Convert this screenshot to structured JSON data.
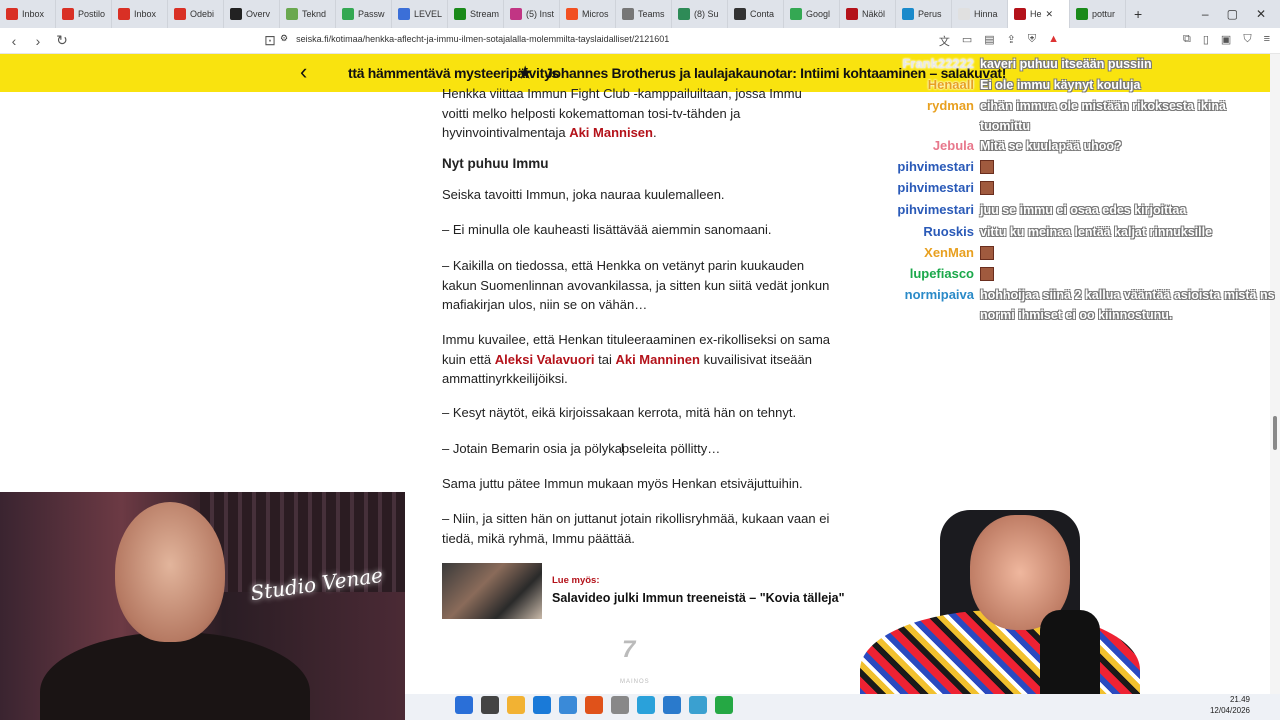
{
  "browser": {
    "tabs": [
      {
        "label": "Inbox",
        "color": "#d93025"
      },
      {
        "label": "Postilo",
        "color": "#d93025"
      },
      {
        "label": "Inbox",
        "color": "#d93025"
      },
      {
        "label": "Odebi",
        "color": "#d93025"
      },
      {
        "label": "Overv",
        "color": "#222222"
      },
      {
        "label": "Teknd",
        "color": "#6aa84f"
      },
      {
        "label": "Passw",
        "color": "#34a853"
      },
      {
        "label": "LEVEL",
        "color": "#3b6fd8"
      },
      {
        "label": "Stream",
        "color": "#1a8a1a"
      },
      {
        "label": "(5) Inst",
        "color": "#c13584"
      },
      {
        "label": "Micros",
        "color": "#f25022"
      },
      {
        "label": "Teams",
        "color": "#777777"
      },
      {
        "label": "(8) Su",
        "color": "#2e8b57"
      },
      {
        "label": "Conta",
        "color": "#333333"
      },
      {
        "label": "Googl",
        "color": "#34a853"
      },
      {
        "label": "Näköl",
        "color": "#b4121a"
      },
      {
        "label": "Perus",
        "color": "#1a8acb"
      },
      {
        "label": "Hinna",
        "color": "#e0e0e0"
      },
      {
        "label": "He",
        "color": "#b4121a",
        "active": true
      },
      {
        "label": "pottur",
        "color": "#1a8a1a"
      }
    ],
    "new_tab": "+",
    "url": "seiska.fi/kotimaa/henkka-aflecht-ja-immu-ilmen-sotajalalla-molemmilta-tayslaidalliset/2121601"
  },
  "banner": {
    "left_text": "ttä hämmentävä mysteeripäivitys",
    "star": "★",
    "right_text": "Johannes Brotherus ja laulajakaunotar: Intiimi kohtaaminen – salakuvat!"
  },
  "article": {
    "p0_a": "Henkka viittaa Immun Fight Club -kamppailuiltaan, jossa Immu voitti melko helposti kokemattoman tosi-tv-tähden ja hyvinvointivalmentaja ",
    "p0_link": "Aki Mannisen",
    "p0_b": ".",
    "heading": "Nyt puhuu Immu",
    "p1": "Seiska tavoitti Immun, joka nauraa kuulemalleen.",
    "p2": "– Ei minulla ole kauheasti lisättävää aiemmin sanomaani.",
    "p3": "– Kaikilla on tiedossa, että Henkka on vetänyt parin kuukauden kakun Suomenlinnan avovankilassa, ja sitten kun siitä vedät jonkun mafiakirjan ulos, niin se on vähän…",
    "p4_a": "Immu kuvailee, että Henkan tituleeraaminen ex-rikolliseksi on sama kuin että ",
    "p4_link1": "Aleksi Valavuori",
    "p4_mid": " tai ",
    "p4_link2": "Aki Manninen",
    "p4_b": " kuvailisivat itseään ammattinyrkkeilijöiksi.",
    "p5": "– Kesyt näytöt, eikä kirjoissakaan kerrota, mitä hän on tehnyt.",
    "p6": "– Jotain Bemarin osia ja pölykapseleita pöllitty…",
    "p7": "Sama juttu pätee Immun mukaan myös Henkan etsiväjuttuihin.",
    "p8": "– Niin, ja sitten hän on juttanut jotain rikollisryhmää, kukaan vaan ei tiedä, mikä ryhmä, Immu päättää.",
    "related_kicker": "Lue myös:",
    "related_title": "Salavideo julki Immun treeneistä – \"Kovia tälleja\"",
    "ad_label": "MAINOS"
  },
  "chat": [
    {
      "name": "Frank22222",
      "color": "#e8e8e8",
      "text": "kaveri puhuu itseään pussiin"
    },
    {
      "name": "Henaall",
      "color": "#e8a020",
      "text": "Ei ole immu käynyt koulujа"
    },
    {
      "name": "rydman",
      "color": "#e8a020",
      "text": "eihän immua ole mistään rikoksesta ikinä tuomittu"
    },
    {
      "name": "Jebula",
      "color": "#e8788c",
      "text": "Mitä se kuulapää uhoo?"
    },
    {
      "name": "pihvimestari",
      "color": "#2a5ab8",
      "text": "",
      "emote": true
    },
    {
      "name": "pihvimestari",
      "color": "#2a5ab8",
      "text": "",
      "emote": true
    },
    {
      "name": "pihvimestari",
      "color": "#2a5ab8",
      "text": "juu se immu ei osaa edes kirjoittaa"
    },
    {
      "name": "Ruoskis",
      "color": "#2a5ab8",
      "text": "vittu ku meinaa lentää kaljat rinnuksille"
    },
    {
      "name": "XenMan",
      "color": "#e8a020",
      "text": "",
      "emote": true
    },
    {
      "name": "lupefiasco",
      "color": "#1aa84a",
      "text": "",
      "emote": true
    },
    {
      "name": "normipaiva",
      "color": "#2a8ac8",
      "text": "hohhoijaa siinä 2 kallua vääntää asioista mistä ns normi ihmiset ei oo kiinnostunu."
    }
  ],
  "webcam1": {
    "neon_sign": "Studio Venae"
  },
  "taskbar": {
    "time": "21.49",
    "date": "12/04/2026",
    "icons": [
      "windows-icon",
      "taskview-icon",
      "explorer-icon",
      "edge-icon",
      "store-icon",
      "brave-icon",
      "app-icon",
      "telegram-icon",
      "vscode-icon",
      "notes-icon",
      "whatsapp-icon"
    ]
  },
  "colors": {
    "banner_bg": "#f9e30f",
    "link_red": "#b4121a"
  }
}
